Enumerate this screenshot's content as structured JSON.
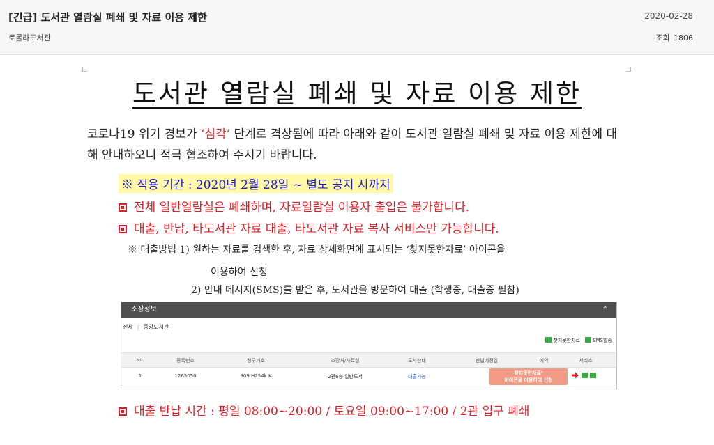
{
  "post": {
    "title": "[긴급] 도서관 열람실 폐쇄 및 자료 이용 제한",
    "author": "로롤라도서관",
    "date": "2020-02-28",
    "views_label": "조회",
    "views": "1806"
  },
  "notice": {
    "title": "도서관 열람실 폐쇄 및 자료 이용 제한",
    "intro_before": "코로나19 위기 경보가 ",
    "intro_highlight": "‘심각’",
    "intro_after": " 단계로 격상됨에 따라 아래와 같이 도서관 열람실 폐쇄 및 자료 이용 제한에 대해 안내하오니 적극 협조하여 주시기 바랍니다.",
    "period": "※ 적용 기간 : 2020년 2월 28일 ~ 별도 공지 시까지",
    "bullet1": "전체 일반열람실은 폐쇄하며, 자료열람실 이용자 출입은 불가합니다.",
    "bullet2": "대출, 반납, 타도서관 자료 대출, 타도서관 자료 복사 서비스만 가능합니다.",
    "note1": "※ 대출방법 1) 원하는 자료를 검색한 후, 자료 상세화면에 표시되는 ‘찾지못한자료’ 아이콘을",
    "note2": "이용하여 신청",
    "note3": "2) 안내 메시지(SMS)를 받은 후, 도서관을 방문하여 대출 (학생증, 대출증 필참)",
    "bullet3": "대출 반납 시간 : 평일 08:00~20:00 / 토요일 09:00~17:00 / 2관 입구 폐쇄"
  },
  "holdings": {
    "title": "소장정보",
    "toggle": "⌃",
    "tabs": [
      "전체",
      "중앙도서관"
    ],
    "action_notfound": "찾지못한자료",
    "action_sms": "SMS발송",
    "columns": [
      "No.",
      "등록번호",
      "청구기호",
      "소장처/자료실",
      "도서상태",
      "반납예정일",
      "예약",
      "서비스"
    ],
    "row": {
      "no": "1",
      "reg_no": "1265050",
      "call_no": "909 H254k K",
      "location": "2관6층 일반도서",
      "status": "대출가능"
    },
    "callout_line1": "찾지못한자료’",
    "callout_line2": "아이콘을 이용하여 신청",
    "colors": {
      "header": "#4f4f4f",
      "callout": "#f29b86",
      "status": "#2b57c9",
      "icon": "#3aa843"
    }
  },
  "colors": {
    "accent_red": "#e01f26",
    "period_text": "#1a1ad6",
    "period_bg": "#fff9a8"
  }
}
